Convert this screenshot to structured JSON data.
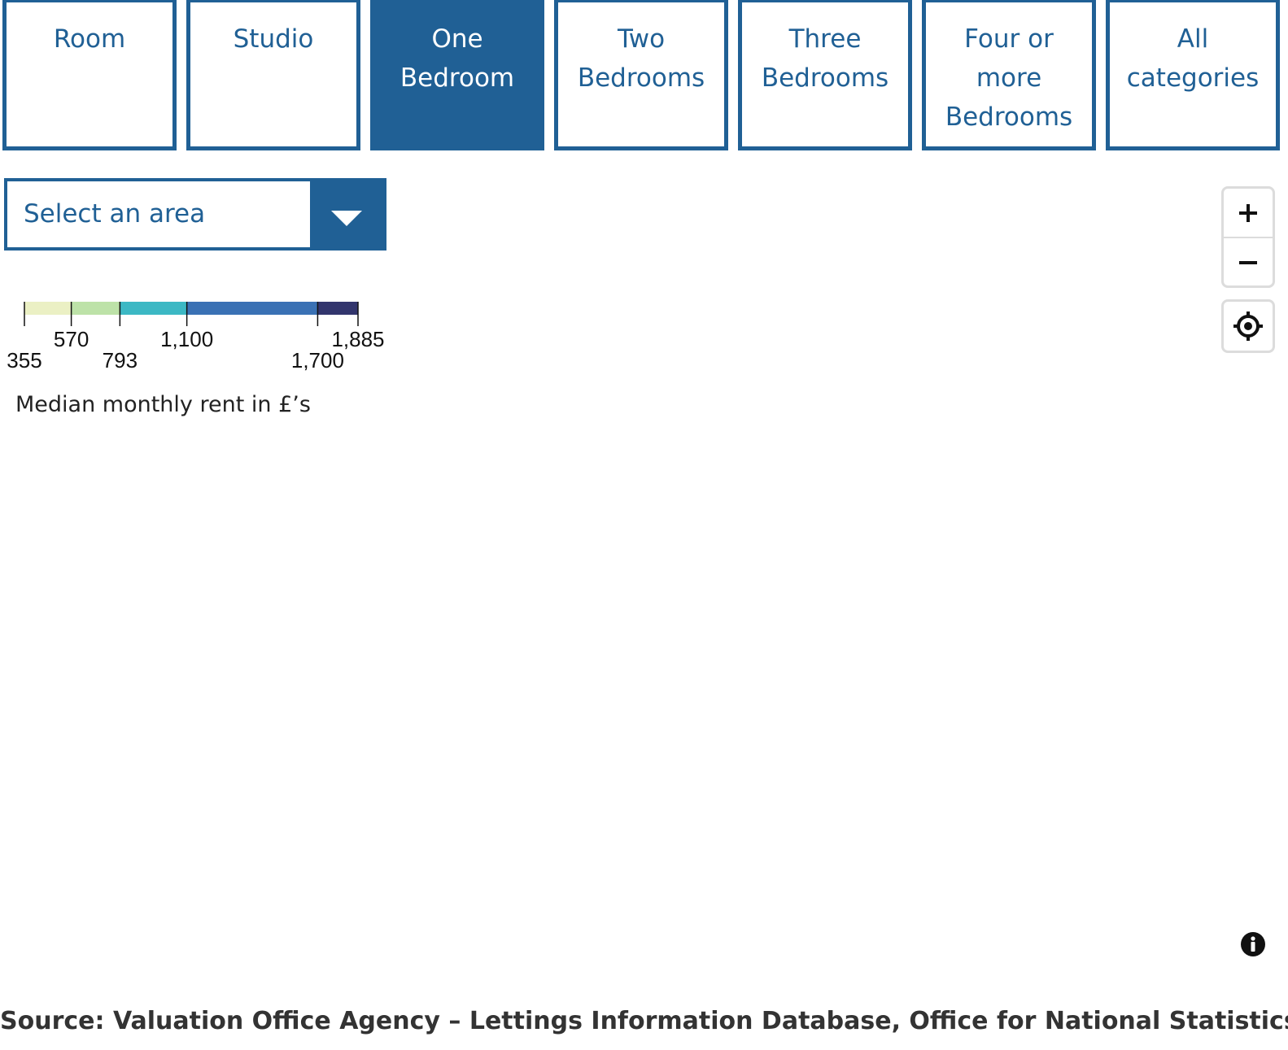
{
  "tabs": [
    {
      "label": "Room",
      "active": false
    },
    {
      "label": "Studio",
      "active": false
    },
    {
      "label": "One Bedroom",
      "active": true
    },
    {
      "label": "Two Bedrooms",
      "active": false
    },
    {
      "label": "Three Bedrooms",
      "active": false
    },
    {
      "label": "Four or more Bedrooms",
      "active": false
    },
    {
      "label": "All categories",
      "active": false
    }
  ],
  "area_select": {
    "label": "Select an area",
    "icon": "chevron-down-icon"
  },
  "legend": {
    "caption": "Median monthly rent in £’s",
    "breaks": [
      355,
      570,
      793,
      1100,
      1700,
      1885
    ],
    "break_labels": [
      "355",
      "570",
      "793",
      "1,100",
      "1,700",
      "1,885"
    ],
    "colors": [
      "#ebf0c4",
      "#bde2a8",
      "#3cb8c4",
      "#3a71b4",
      "#32356d"
    ]
  },
  "map_controls": {
    "zoom_in_icon": "plus-icon",
    "zoom_out_icon": "minus-icon",
    "locate_icon": "crosshair-icon",
    "info_icon": "info-icon"
  },
  "source": "Source: Valuation Office Agency – Lettings Information Database, Office for National Statistics."
}
